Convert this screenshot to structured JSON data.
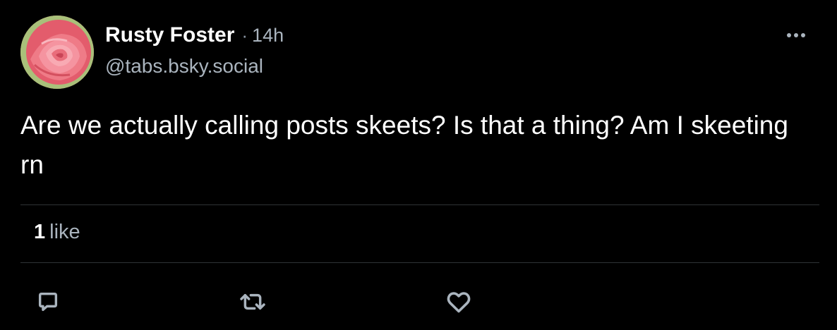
{
  "post": {
    "author": {
      "display_name": "Rusty Foster",
      "separator": "·",
      "time": "14h",
      "handle": "@tabs.bsky.social"
    },
    "text": "Are we actually calling posts skeets? Is that a thing? Am I skeeting rn",
    "stats": {
      "like_count": "1",
      "like_label": "like"
    }
  },
  "icons": {
    "avatar": "rose-photo",
    "more": "ellipsis-icon",
    "reply": "speech-bubble-icon",
    "repost": "repost-arrows-icon",
    "like": "heart-outline-icon"
  },
  "colors": {
    "background": "#000000",
    "primary_text": "#ffffff",
    "secondary_text": "#aab4be",
    "icon": "#aab4be",
    "divider": "#2f3336"
  }
}
